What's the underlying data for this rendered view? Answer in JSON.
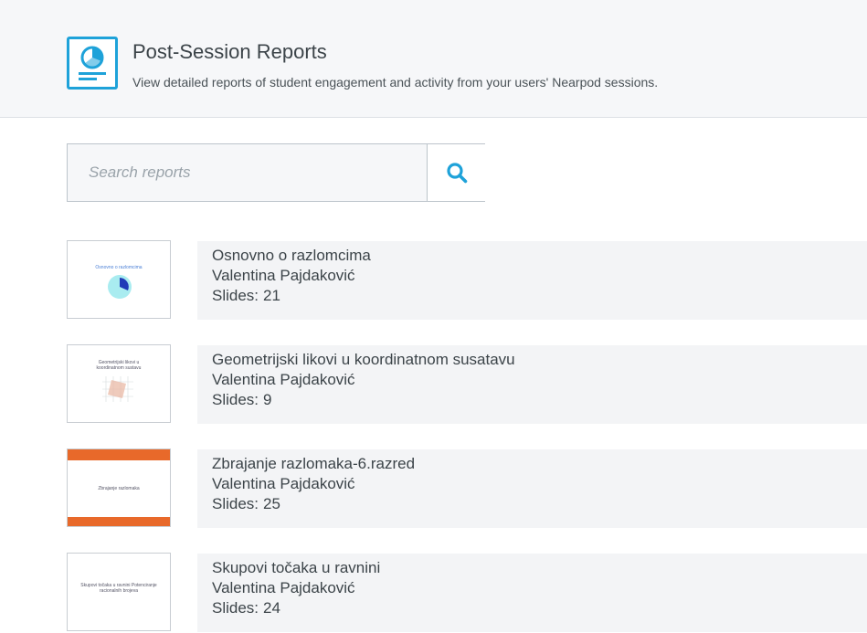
{
  "header": {
    "title": "Post-Session Reports",
    "subtitle": "View detailed reports of student engagement and activity from your users' Nearpod sessions.",
    "accent_color": "#1ea2d9",
    "icon": "report-chart-icon"
  },
  "search": {
    "placeholder": "Search reports",
    "value": "",
    "button_icon": "search-icon"
  },
  "reports": [
    {
      "title": "Osnovno o razlomcima",
      "author": "Valentina Pajdaković",
      "slides_label": "Slides:",
      "slides": "21",
      "thumb_text": "Osnovno o razlomcima"
    },
    {
      "title": "Geometrijski likovi u koordinatnom susatavu",
      "author": "Valentina Pajdaković",
      "slides_label": "Slides:",
      "slides": "9",
      "thumb_text": "Geometrijski likovi u koordinatnom sustavu"
    },
    {
      "title": "Zbrajanje razlomaka-6.razred",
      "author": "Valentina Pajdaković",
      "slides_label": "Slides:",
      "slides": "25",
      "thumb_text": "Zbrajanje razlomaka"
    },
    {
      "title": "Skupovi točaka u ravnini",
      "author": "Valentina Pajdaković",
      "slides_label": "Slides:",
      "slides": "24",
      "thumb_text": "Skupovi točaka u ravnini Potenciranje racionalnih brojeva"
    }
  ]
}
